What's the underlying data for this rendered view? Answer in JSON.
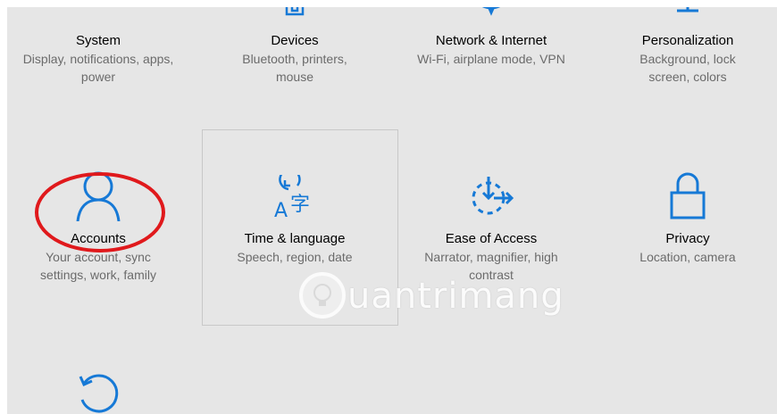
{
  "colors": {
    "background": "#e6e6e6",
    "accent": "#1679d6",
    "annotation": "#e0191c",
    "title_text": "#000000",
    "description_text": "#6b6b6b"
  },
  "tiles": [
    {
      "title": "System",
      "description": "Display, notifications, apps, power",
      "icon": "display-icon"
    },
    {
      "title": "Devices",
      "description": "Bluetooth, printers, mouse",
      "icon": "devices-icon"
    },
    {
      "title": "Network & Internet",
      "description": "Wi-Fi, airplane mode, VPN",
      "icon": "globe-icon"
    },
    {
      "title": "Personalization",
      "description": "Background, lock screen, colors",
      "icon": "personalization-icon"
    },
    {
      "title": "Accounts",
      "description": "Your account, sync settings, work, family",
      "icon": "person-icon"
    },
    {
      "title": "Time & language",
      "description": "Speech, region, date",
      "icon": "time-language-icon"
    },
    {
      "title": "Ease of Access",
      "description": "Narrator, magnifier, high contrast",
      "icon": "ease-of-access-icon"
    },
    {
      "title": "Privacy",
      "description": "Location, camera",
      "icon": "lock-icon"
    },
    {
      "title": "",
      "description": "",
      "icon": "update-security-icon"
    }
  ],
  "watermark": {
    "text": "uantrimang",
    "icon": "lightbulb-icon"
  },
  "annotation": {
    "shape": "ellipse",
    "target": "Accounts"
  }
}
